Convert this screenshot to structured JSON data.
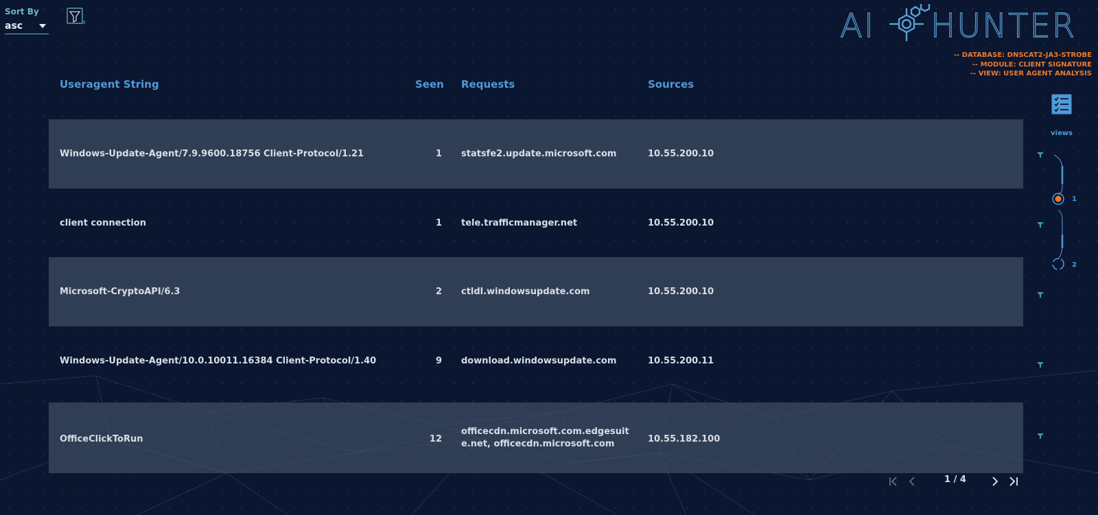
{
  "sort": {
    "label": "Sort By",
    "value": "asc"
  },
  "filter": {
    "count": "3"
  },
  "brand": {
    "left": "AI",
    "right": "HUNTER"
  },
  "meta": {
    "database": "-- DATABASE: DNSCAT2-JA3-STROBE",
    "module": "-- MODULE: CLIENT SIGNATURE",
    "view": "-- VIEW: USER AGENT ANALYSIS"
  },
  "columns": {
    "useragent": "Useragent String",
    "seen": "Seen",
    "requests": "Requests",
    "sources": "Sources"
  },
  "rows": [
    {
      "useragent": "Windows-Update-Agent/7.9.9600.18756 Client-Protocol/1.21",
      "seen": "1",
      "requests": "statsfe2.update.microsoft.com",
      "sources": "10.55.200.10"
    },
    {
      "useragent": "client connection",
      "seen": "1",
      "requests": "tele.trafficmanager.net",
      "sources": "10.55.200.10"
    },
    {
      "useragent": "Microsoft-CryptoAPI/6.3",
      "seen": "2",
      "requests": "ctldl.windowsupdate.com",
      "sources": "10.55.200.10"
    },
    {
      "useragent": "Windows-Update-Agent/10.0.10011.16384 Client-Protocol/1.40",
      "seen": "9",
      "requests": "download.windowsupdate.com",
      "sources": "10.55.200.11"
    },
    {
      "useragent": "OfficeClickToRun",
      "seen": "12",
      "requests": "officecdn.microsoft.com.edgesuite.net, officecdn.microsoft.com",
      "sources": "10.55.182.100"
    }
  ],
  "sidebar": {
    "views_label": "views",
    "view_1": "1",
    "view_2": "2"
  },
  "pagination": {
    "current": "1 / 4"
  },
  "colors": {
    "accent": "#4f9ad6",
    "meta": "#e8792c",
    "active_view": "#e8792c",
    "background": "#0b1630"
  }
}
